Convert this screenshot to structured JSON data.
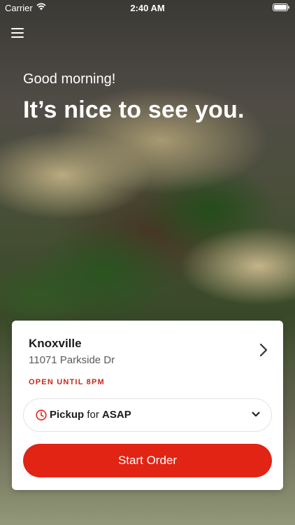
{
  "status_bar": {
    "carrier": "Carrier",
    "time": "2:40 AM"
  },
  "icons": {
    "menu": "hamburger-menu-icon",
    "wifi": "wifi-icon",
    "battery": "battery-icon",
    "clock": "clock-icon",
    "chevron_right": "chevron-right-icon",
    "chevron_down": "chevron-down-icon"
  },
  "hero": {
    "greeting": "Good morning!",
    "headline": "It’s nice to see you."
  },
  "location": {
    "name": "Knoxville",
    "address": "11071 Parkside Dr",
    "status": "OPEN UNTIL 8PM"
  },
  "order_mode": {
    "mode": "Pickup",
    "connector": "for",
    "time": "ASAP"
  },
  "cta": {
    "label": "Start Order"
  },
  "colors": {
    "accent": "#e12414",
    "status_text": "#c8281b"
  }
}
